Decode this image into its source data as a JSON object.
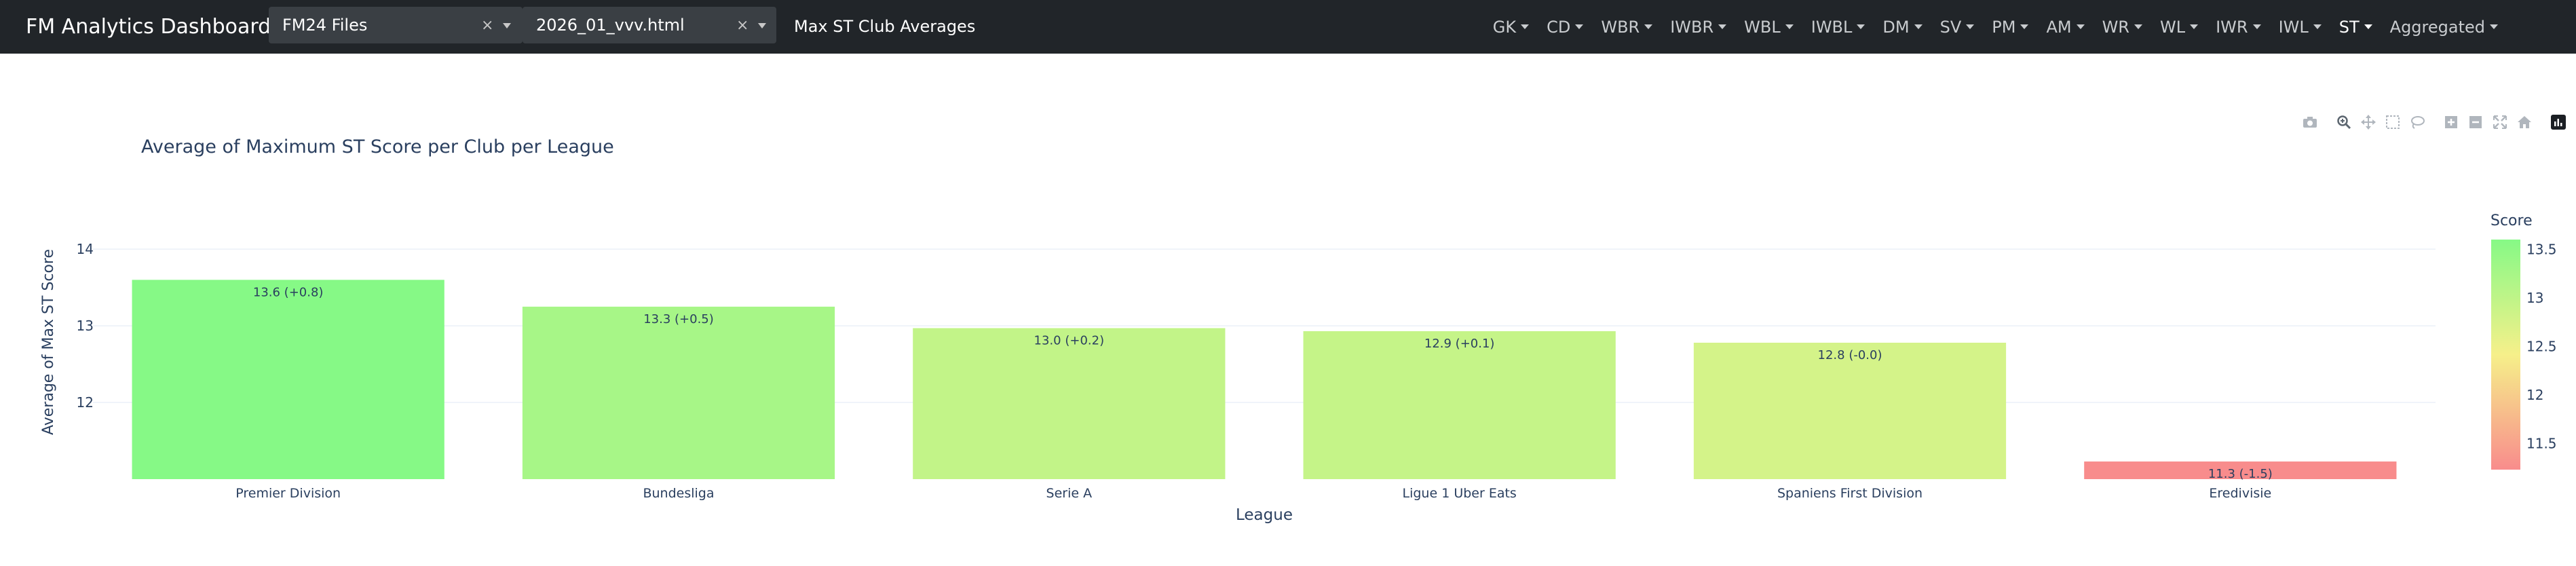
{
  "app": {
    "title": "FM Analytics Dashboard"
  },
  "controls": {
    "collection": {
      "value": "FM24 Files",
      "clear": "×"
    },
    "file": {
      "value": "2026_01_vvv.html",
      "clear": "×"
    },
    "page_label": "Max ST Club Averages"
  },
  "nav": {
    "items": [
      "GK",
      "CD",
      "WBR",
      "IWBR",
      "WBL",
      "IWBL",
      "DM",
      "SV",
      "PM",
      "AM",
      "WR",
      "WL",
      "IWR",
      "IWL",
      "ST",
      "Aggregated"
    ],
    "active": "ST"
  },
  "chart_data": {
    "type": "bar",
    "title": "Average of Maximum ST Score per Club per League",
    "xlabel": "League",
    "ylabel": "Average of Max ST Score",
    "categories": [
      "Premier Division",
      "Bundesliga",
      "Serie A",
      "Ligue 1 Uber Eats",
      "Spaniens First Division",
      "Eredivisie"
    ],
    "values": [
      13.6,
      13.25,
      12.97,
      12.93,
      12.78,
      11.23
    ],
    "labels": [
      "13.6 (+0.8)",
      "13.3 (+0.5)",
      "13.0 (+0.2)",
      "12.9 (+0.1)",
      "12.8 (-0.0)",
      "11.3 (-1.5)"
    ],
    "ylim": [
      11,
      14.4
    ],
    "yticks": [
      12,
      13,
      14
    ],
    "grid": true,
    "colorbar": {
      "title": "Score",
      "range": [
        11.23,
        13.6
      ],
      "ticks": [
        "13.5",
        "13",
        "12.5",
        "12",
        "11.5"
      ],
      "tick_values": [
        13.5,
        13,
        12.5,
        12,
        11.5
      ],
      "colors": [
        "#f88c8c",
        "#f6f08a",
        "#86f986"
      ]
    }
  }
}
